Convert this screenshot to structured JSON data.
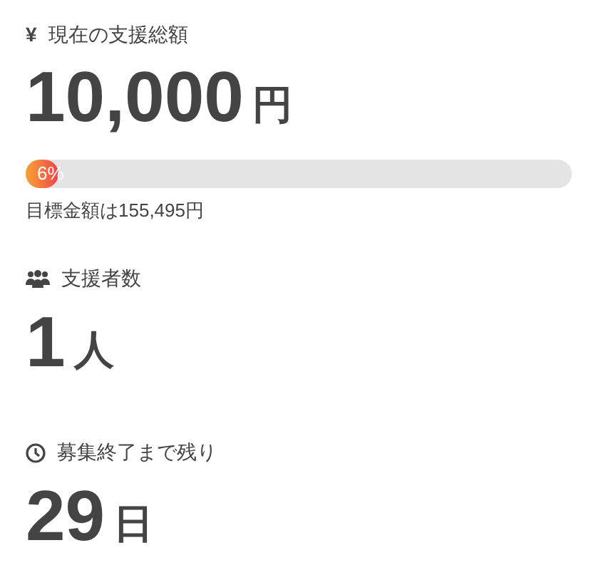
{
  "sections": [
    {
      "kind": "amount",
      "icon_text": "¥",
      "label": "現在の支援総額",
      "value": "10,000",
      "unit": "円",
      "progress": {
        "level": 0.06,
        "reading": "6%"
      },
      "note": "目標金額は155,495円"
    },
    {
      "kind": "supporters",
      "label": "支援者数",
      "value": "1",
      "unit": "人"
    },
    {
      "kind": "deadline",
      "label": "募集終了まで残り",
      "value": "29",
      "unit": "日"
    }
  ]
}
